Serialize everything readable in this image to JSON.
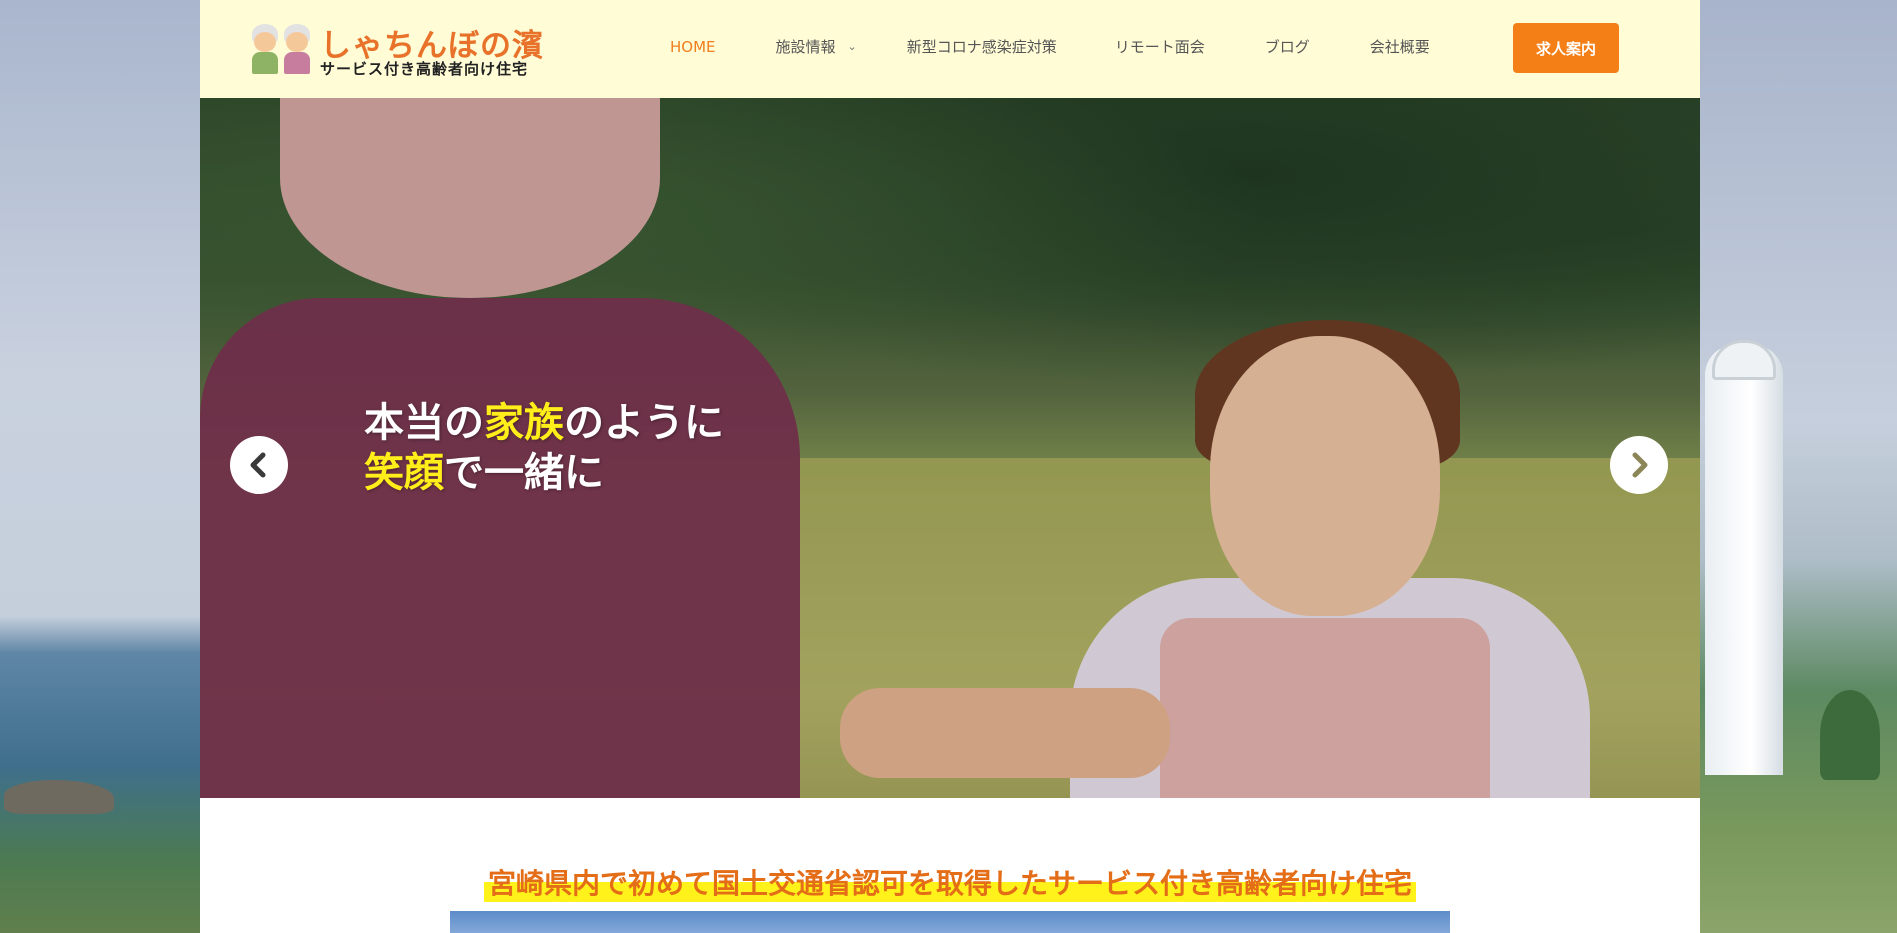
{
  "header": {
    "logo": {
      "title": "しゃちんぼの濱",
      "subtitle": "サービス付き高齢者向け住宅"
    },
    "nav": [
      {
        "label": "HOME",
        "active": true
      },
      {
        "label": "施設情報",
        "has_dropdown": true
      },
      {
        "label": "新型コロナ感染症対策"
      },
      {
        "label": "リモート面会"
      },
      {
        "label": "ブログ"
      },
      {
        "label": "会社概要"
      }
    ],
    "cta_label": "求人案内"
  },
  "hero": {
    "line1": {
      "part1": "本当の",
      "highlight": "家族",
      "part2": "のように"
    },
    "line2": {
      "highlight": "笑顔",
      "part2": "で一緒に"
    },
    "prev_icon": "chevron-left-icon",
    "next_icon": "chevron-right-icon"
  },
  "intro": {
    "tagline": "宮崎県内で初めて国土交通省認可を取得したサービス付き高齢者向け住宅"
  },
  "colors": {
    "header_bg": "#fffcd6",
    "accent": "#f57f17",
    "active_nav": "#f07e1e",
    "highlight_text": "#ffee1a",
    "tagline_text": "#e46d17",
    "tagline_marker": "#fff21a"
  }
}
